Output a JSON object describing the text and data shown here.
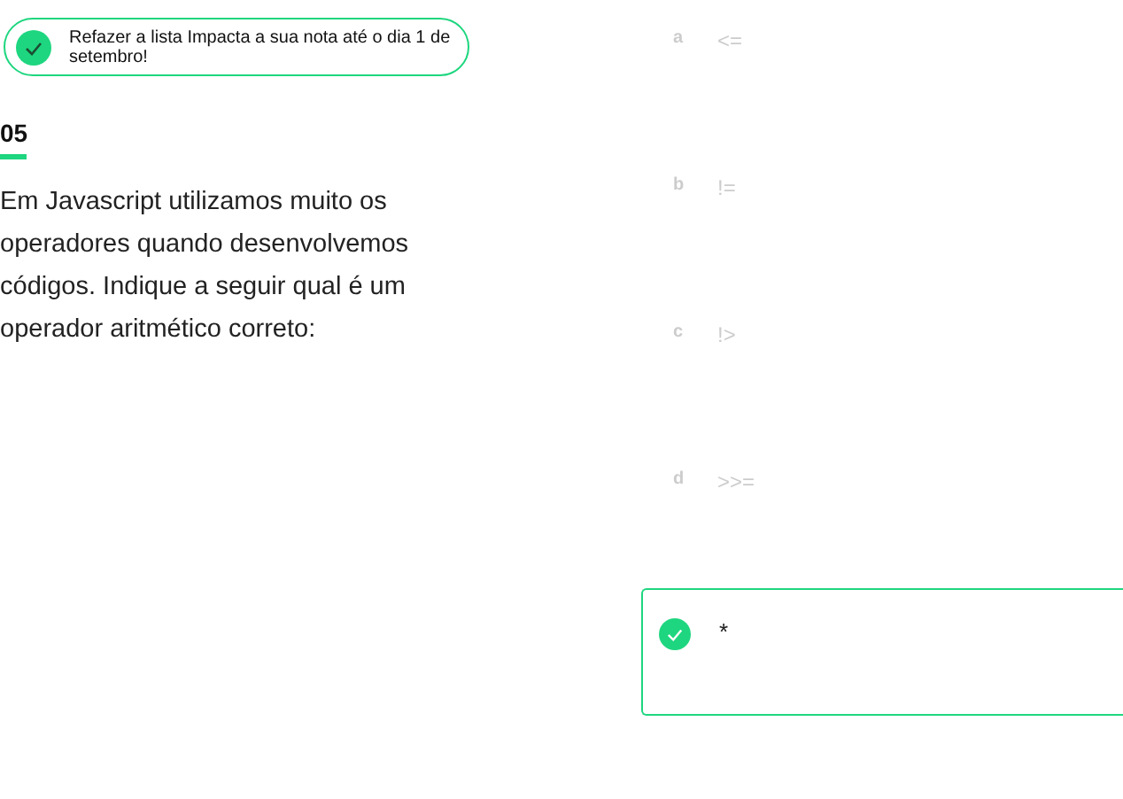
{
  "notice": {
    "text": "Refazer a lista Impacta a sua nota até o dia 1 de setembro!",
    "checked": true
  },
  "question": {
    "number": "05",
    "text": "Em Javascript utilizamos muito os operadores quando desenvolvemos códigos. Indique a seguir qual é um operador aritmético correto:"
  },
  "options": [
    {
      "letter": "a",
      "text": "<=",
      "selected": false
    },
    {
      "letter": "b",
      "text": "!=",
      "selected": false
    },
    {
      "letter": "c",
      "text": "!>",
      "selected": false
    },
    {
      "letter": "d",
      "text": ">>=",
      "selected": false
    },
    {
      "text": "*",
      "selected": true
    }
  ]
}
